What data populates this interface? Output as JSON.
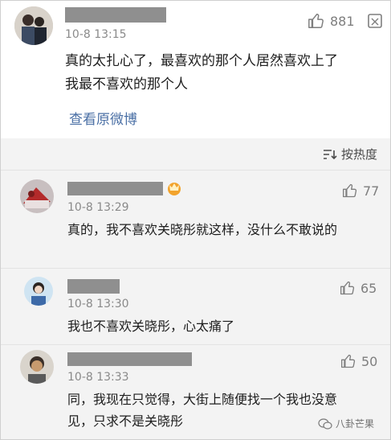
{
  "post": {
    "time": "10-8 13:15",
    "likes": "881",
    "content": "真的太扎心了，最喜欢的那个人居然喜欢上了我最不喜欢的那个人",
    "view_original": "查看原微博"
  },
  "sort": {
    "label": "按热度"
  },
  "comments": [
    {
      "time": "10-8 13:29",
      "likes": "77",
      "content": "真的，我不喜欢关晓彤就这样，没什么不敢说的"
    },
    {
      "time": "10-8 13:30",
      "likes": "65",
      "content": "我也不喜欢关晓彤，心太痛了"
    },
    {
      "time": "10-8 13:33",
      "likes": "50",
      "content": "同，我现在只觉得，大街上随便找一个我也没意见，只求不是关晓彤"
    }
  ],
  "watermark": {
    "text": "八卦芒果"
  },
  "colors": {
    "link": "#4a6fa5",
    "comments_bg": "#f3f3f3"
  }
}
